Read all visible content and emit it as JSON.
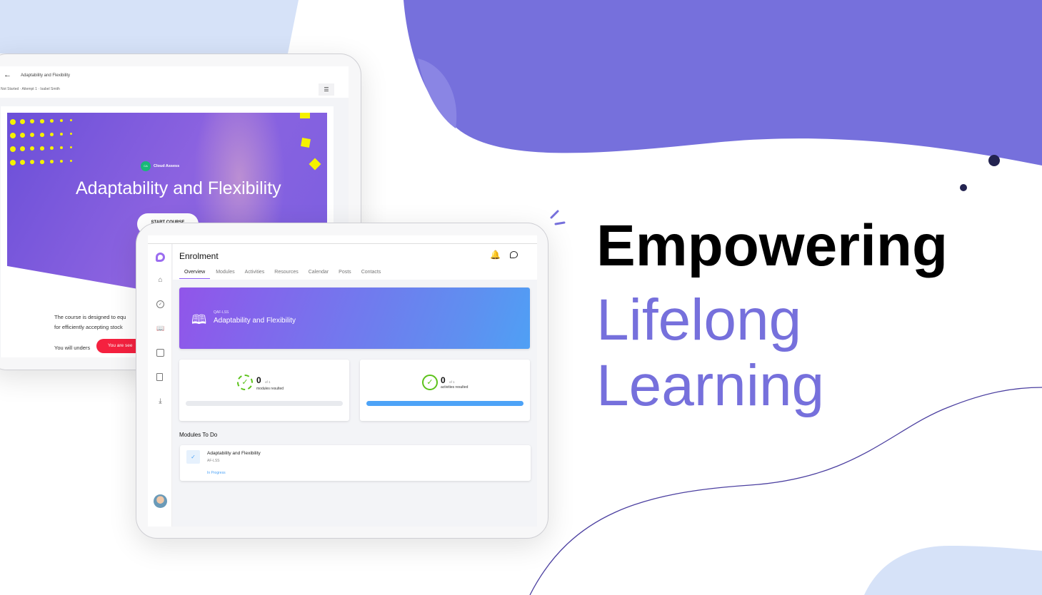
{
  "headline": {
    "line1": "Empowering",
    "line2": "Lifelong",
    "line3": "Learning"
  },
  "colors": {
    "brand_purple": "#7670dc",
    "light_blue": "#d6e2f8",
    "navy": "#232350",
    "progress_blue": "#4da3f7",
    "check_green": "#5cc21a"
  },
  "course_player": {
    "title": "Adaptability and Flexibility",
    "meta": "Not Started · Attempt 1 · Isabel Smith",
    "hero_brand_initials": "CA",
    "hero_brand": "Cloud Assess",
    "hero_title": "Adaptability and Flexibility",
    "start_button": "START COURSE",
    "body_line1": "The course is designed to equ",
    "body_line2": "for efficiently accepting stock",
    "body_line3": "You will unders",
    "toast": "You are see"
  },
  "enrolment": {
    "title": "Enrolment",
    "tabs": [
      "Overview",
      "Modules",
      "Activities",
      "Resources",
      "Calendar",
      "Posts",
      "Contacts"
    ],
    "active_tab": "Overview",
    "banner": {
      "code": "QAF-LSS",
      "title": "Adaptability and Flexibility"
    },
    "stats": [
      {
        "value": "0",
        "of": "of 1",
        "label": "modules resulted",
        "progress": 0
      },
      {
        "value": "0",
        "of": "of 1",
        "label": "activities resulted",
        "progress": 100
      }
    ],
    "modules_heading": "Modules To Do",
    "modules": [
      {
        "title": "Adaptability and Flexibility",
        "code": "AF-LSS",
        "status": "In Progress"
      }
    ]
  }
}
